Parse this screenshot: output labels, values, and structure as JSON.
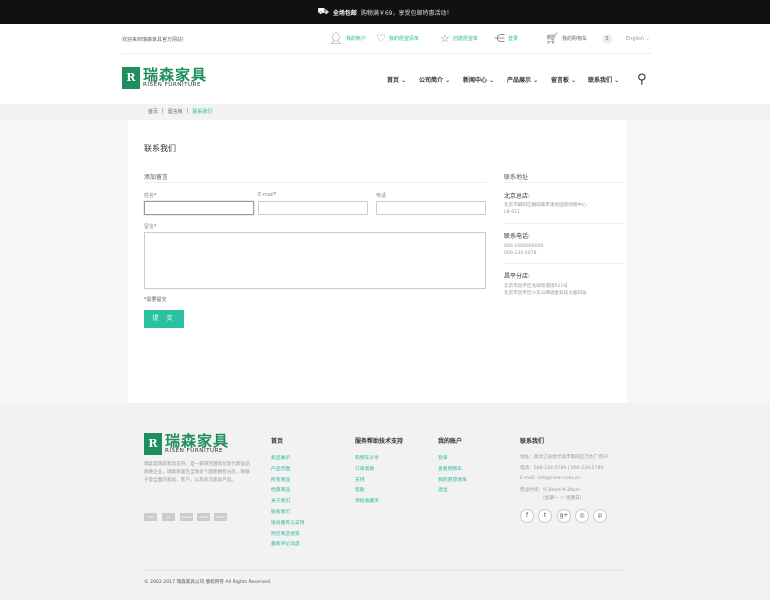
{
  "topbar": {
    "bold": "全场包邮",
    "text": "购物满￥69，享受包邮特惠活动！"
  },
  "header": {
    "welcome": "欢迎来到瑞森家具官方网站!",
    "my_account": "我的账户",
    "wishlist": "我的愿望清单",
    "create_wish": "创建愿望单",
    "login": "登录",
    "cart": "我的购物车",
    "cart_count": "0",
    "lang": "English"
  },
  "logo": {
    "mark": "R",
    "cn": "瑞森家具",
    "en": "RISEN FURNITURE"
  },
  "nav": [
    "首页",
    "公司简介",
    "新闻中心",
    "产品展示",
    "留言板",
    "联系我们"
  ],
  "breadcrumb": [
    "首页",
    "留言板",
    "联系我们"
  ],
  "page_title": "联系我们",
  "form": {
    "heading": "添加留言",
    "name_label": "姓名",
    "email_label": "E-mail",
    "phone_label": "电话",
    "message_label": "留言",
    "required_note": "需要提交",
    "submit": "提 交"
  },
  "address": {
    "heading": "联系地址",
    "hq_title": "北京总店:",
    "hq_lines": [
      "北京市朝阳区朝阳路苹果地国际购物中心",
      "LB-011"
    ],
    "tel_title": "联系电话:",
    "tel_lines": [
      "400 1000000000",
      "000-234-5678"
    ],
    "branch_title": "昌平分店:",
    "branch_lines": [
      "北京市昌平区龙域新城街021号",
      "北京市昌平区小东山璜珑金科技大厦四层"
    ]
  },
  "footer": {
    "desc": "瑞森是瑞森家具支持，是一家研究国际化现代家居品牌重企业，瑞森家居在全球多个国家拥有分店，致敬于意全面的家具，客户，以及前沿家具产品。",
    "payments": [
      "VISA",
      "CC",
      "PayPal",
      "AMEX",
      "BANK"
    ],
    "col1": {
      "title": "首页",
      "items": [
        "新品展示",
        "产品页面",
        "所有商品",
        "经典商品",
        "关于我们",
        "联系我们",
        "接员服务与支持",
        "附近商店搜索",
        "最新评论动态"
      ]
    },
    "col2": {
      "title": "服务帮助技术支持",
      "items": [
        "购物车分享",
        "订单帮助",
        "支持",
        "帮助",
        "添加收藏夹"
      ]
    },
    "col3": {
      "title": "我的账户",
      "items": [
        "登录",
        "查看购物车",
        "我的愿望清单",
        "退出"
      ]
    },
    "contact": {
      "title": "联系我们",
      "lines": [
        "地址：黑龙江省哈尔滨市南岗区万达广场1F",
        "电话：000-234-5789 | 000-234-5789",
        "E-mail: info@risen.com.cn",
        "营业时间：9:30am-9:30pm",
        "（星期一 ～ 星期日）"
      ]
    },
    "social": [
      "f",
      "t",
      "g+",
      "◎",
      "p"
    ],
    "copyright": "© 2002-2017 瑞森家具公司 版权所有  All Rights Reserved."
  }
}
